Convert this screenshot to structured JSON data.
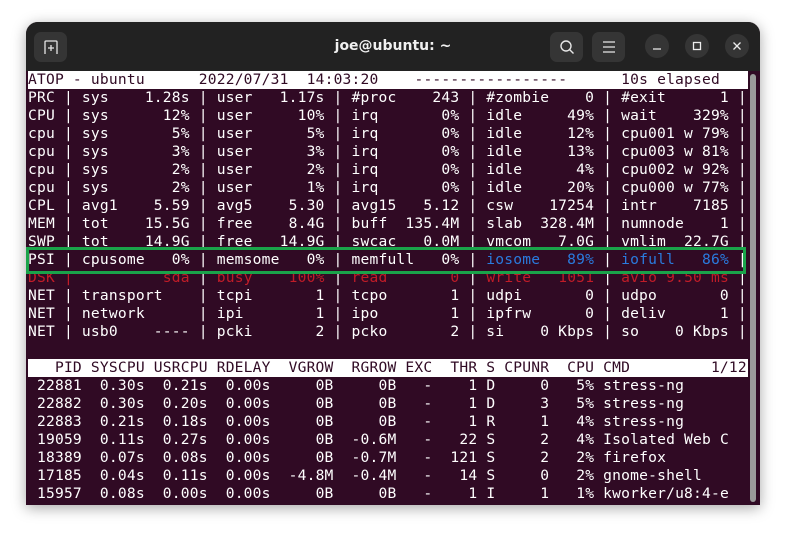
{
  "window": {
    "title": "joe@ubuntu: ~",
    "new_tab_icon": "new-tab-icon",
    "search_icon": "search-icon",
    "menu_icon": "hamburger-menu-icon",
    "minimize_icon": "minimize-icon",
    "maximize_icon": "maximize-icon",
    "close_icon": "close-icon"
  },
  "colors": {
    "terminal_bg": "#300a24",
    "highlight_box": "#1aa34a",
    "disk_red": "#c01c28",
    "psi_io_blue": "#2a7bde"
  },
  "atop": {
    "header": {
      "host": "ATOP - ubuntu",
      "date": "2022/07/31",
      "time": "14:03:20",
      "dashes": "-----------------",
      "elapsed": "10s elapsed"
    },
    "system_lines": [
      "PRC | sys    1.28s | user   1.17s | #proc    243 | #zombie    0 | #exit      1 |",
      "CPU | sys      12% | user     10% | irq       0% | idle     49% | wait    329% |",
      "cpu | sys       5% | user      5% | irq       0% | idle     12% | cpu001 w 79% |",
      "cpu | sys       3% | user      3% | irq       0% | idle     13% | cpu003 w 81% |",
      "cpu | sys       2% | user      2% | irq       0% | idle      4% | cpu002 w 92% |",
      "cpu | sys       2% | user      1% | irq       0% | idle     20% | cpu000 w 77% |",
      "CPL | avg1    5.59 | avg5    5.30 | avg15   5.12 | csw    17254 | intr    7185 |",
      "MEM | tot    15.5G | free    8.4G | buff  135.4M | slab  328.4M | numnode    1 |",
      "SWP | tot    14.9G | free   14.9G | swcac   0.0M | vmcom   7.0G | vmlim  22.7G |"
    ],
    "psi_line": {
      "part1": "PSI | cpusome   0% | memsome   0% | memfull   0% | ",
      "part2": "iosome   89%",
      "part3": " | ",
      "part4": "iofull   86%",
      "part5": " |"
    },
    "dsk_line": {
      "part1": "DSK |",
      "part2": "          sda",
      "part3": " | ",
      "part4": "busy    100%",
      "part5": " | ",
      "part6": "read       0",
      "part7": " | ",
      "part8": "write   1051",
      "part9": " | ",
      "part10": "avio 9.50 ms",
      "part11": " |"
    },
    "net_lines": [
      "NET | transport    | tcpi       1 | tcpo       1 | udpi       0 | udpo       0 |",
      "NET | network      | ipi        1 | ipo        1 | ipfrw      0 | deliv      1 |",
      "NET | usb0    ---- | pcki       2 | pcko       2 | si    0 Kbps | so    0 Kbps |"
    ],
    "process_header": "   PID SYSCPU USRCPU RDELAY  VGROW  RGROW EXC  THR S CPUNR  CPU CMD         1/12",
    "process_columns": [
      "PID",
      "SYSCPU",
      "USRCPU",
      "RDELAY",
      "VGROW",
      "RGROW",
      "EXC",
      "THR",
      "S",
      "CPUNR",
      "CPU",
      "CMD"
    ],
    "page_indicator": "1/12",
    "processes": [
      {
        "pid": "22881",
        "syscpu": "0.30s",
        "usrcpu": "0.21s",
        "rdelay": "0.00s",
        "vgrow": "0B",
        "rgrow": "0B",
        "exc": "-",
        "thr": "1",
        "s": "D",
        "cpunr": "0",
        "cpu": "5%",
        "cmd": "stress-ng"
      },
      {
        "pid": "22882",
        "syscpu": "0.30s",
        "usrcpu": "0.20s",
        "rdelay": "0.00s",
        "vgrow": "0B",
        "rgrow": "0B",
        "exc": "-",
        "thr": "1",
        "s": "D",
        "cpunr": "3",
        "cpu": "5%",
        "cmd": "stress-ng"
      },
      {
        "pid": "22883",
        "syscpu": "0.21s",
        "usrcpu": "0.18s",
        "rdelay": "0.00s",
        "vgrow": "0B",
        "rgrow": "0B",
        "exc": "-",
        "thr": "1",
        "s": "R",
        "cpunr": "1",
        "cpu": "4%",
        "cmd": "stress-ng"
      },
      {
        "pid": "19059",
        "syscpu": "0.11s",
        "usrcpu": "0.27s",
        "rdelay": "0.00s",
        "vgrow": "0B",
        "rgrow": "-0.6M",
        "exc": "-",
        "thr": "22",
        "s": "S",
        "cpunr": "2",
        "cpu": "4%",
        "cmd": "Isolated Web C"
      },
      {
        "pid": "18389",
        "syscpu": "0.07s",
        "usrcpu": "0.08s",
        "rdelay": "0.00s",
        "vgrow": "0B",
        "rgrow": "-0.7M",
        "exc": "-",
        "thr": "121",
        "s": "S",
        "cpunr": "2",
        "cpu": "2%",
        "cmd": "firefox"
      },
      {
        "pid": "17185",
        "syscpu": "0.04s",
        "usrcpu": "0.11s",
        "rdelay": "0.00s",
        "vgrow": "-4.8M",
        "rgrow": "-0.4M",
        "exc": "-",
        "thr": "14",
        "s": "S",
        "cpunr": "0",
        "cpu": "2%",
        "cmd": "gnome-shell"
      },
      {
        "pid": "15957",
        "syscpu": "0.08s",
        "usrcpu": "0.00s",
        "rdelay": "0.00s",
        "vgrow": "0B",
        "rgrow": "0B",
        "exc": "-",
        "thr": "1",
        "s": "I",
        "cpunr": "1",
        "cpu": "1%",
        "cmd": "kworker/u8:4-e"
      }
    ]
  }
}
